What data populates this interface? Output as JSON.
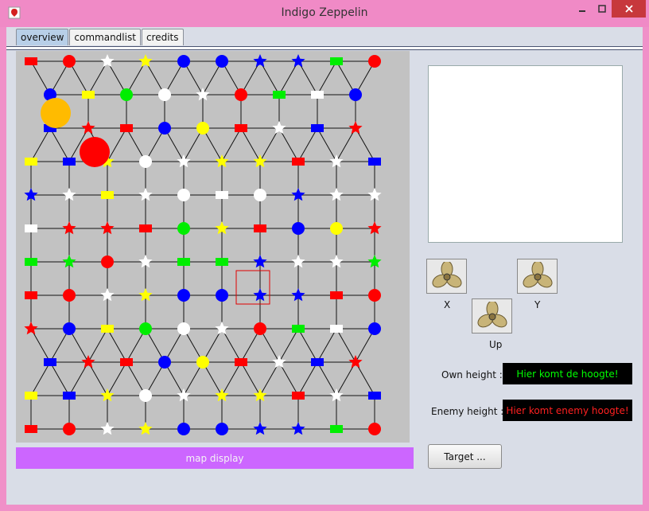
{
  "window": {
    "title": "Indigo Zeppelin"
  },
  "tabs": [
    "overview",
    "commandlist",
    "credits"
  ],
  "map": {
    "label": "map display",
    "colors": {
      "red": "#ff0000",
      "blue": "#0000ff",
      "yellow": "#ffff00",
      "white": "#ffffff",
      "green": "#00ee00",
      "orange": "#ffbb00"
    },
    "rows": [
      [
        "rR",
        "cR",
        "sW",
        "sY",
        "cB",
        "cB",
        "sB",
        "sB",
        "rG",
        "cR"
      ],
      [
        "cB",
        "rY",
        "cG",
        "cW",
        "sW",
        "cR",
        "rG",
        "rW",
        "cB"
      ],
      [
        "rB",
        "sR",
        "rR",
        "cB",
        "cY",
        "rR",
        "sW",
        "rB",
        "sR"
      ],
      [
        "rY",
        "rB",
        "sY",
        "cW",
        "sW",
        "sY",
        "sY",
        "rR",
        "sW",
        "rB"
      ],
      [
        "sB",
        "sW",
        "rY",
        "sW",
        "cW",
        "rW",
        "cW",
        "sB",
        "sW",
        "sW"
      ],
      [
        "rW",
        "sR",
        "sR",
        "rR",
        "cG",
        "sY",
        "rR",
        "cB",
        "cY",
        "sR"
      ],
      [
        "rG",
        "sG",
        "cR",
        "sW",
        "rG",
        "rG",
        "sB",
        "sW",
        "sW",
        "sG"
      ],
      [
        "rR",
        "cR",
        "sW",
        "sY",
        "cB",
        "cB",
        "sB",
        "sB",
        "rR",
        "cR"
      ],
      [
        "sR",
        "cB",
        "rY",
        "cG",
        "cW",
        "sW",
        "cR",
        "rG",
        "rW",
        "cB"
      ],
      [
        "rB",
        "sR",
        "rR",
        "cB",
        "cY",
        "rR",
        "sW",
        "rB",
        "sR"
      ],
      [
        "rY",
        "rB",
        "sY",
        "cW",
        "sW",
        "sY",
        "sY",
        "rR",
        "sW",
        "rB"
      ],
      [
        "rR",
        "cR",
        "sW",
        "sY",
        "cB",
        "cB",
        "sB",
        "sB",
        "rG",
        "cR"
      ]
    ],
    "big_markers": [
      {
        "color": "orange"
      },
      {
        "color": "red"
      }
    ]
  },
  "controls": {
    "x_label": "X",
    "y_label": "Y",
    "up_label": "Up",
    "propeller_icon": "propeller-icon"
  },
  "heights": {
    "own_label": "Own height :",
    "own_value": "Hier komt de hoogte!",
    "own_color": "#00ff00",
    "enemy_label": "Enemy height :",
    "enemy_value": "Hier komt enemy hoogte!",
    "enemy_color": "#ff2020"
  },
  "target_button": "Target ..."
}
